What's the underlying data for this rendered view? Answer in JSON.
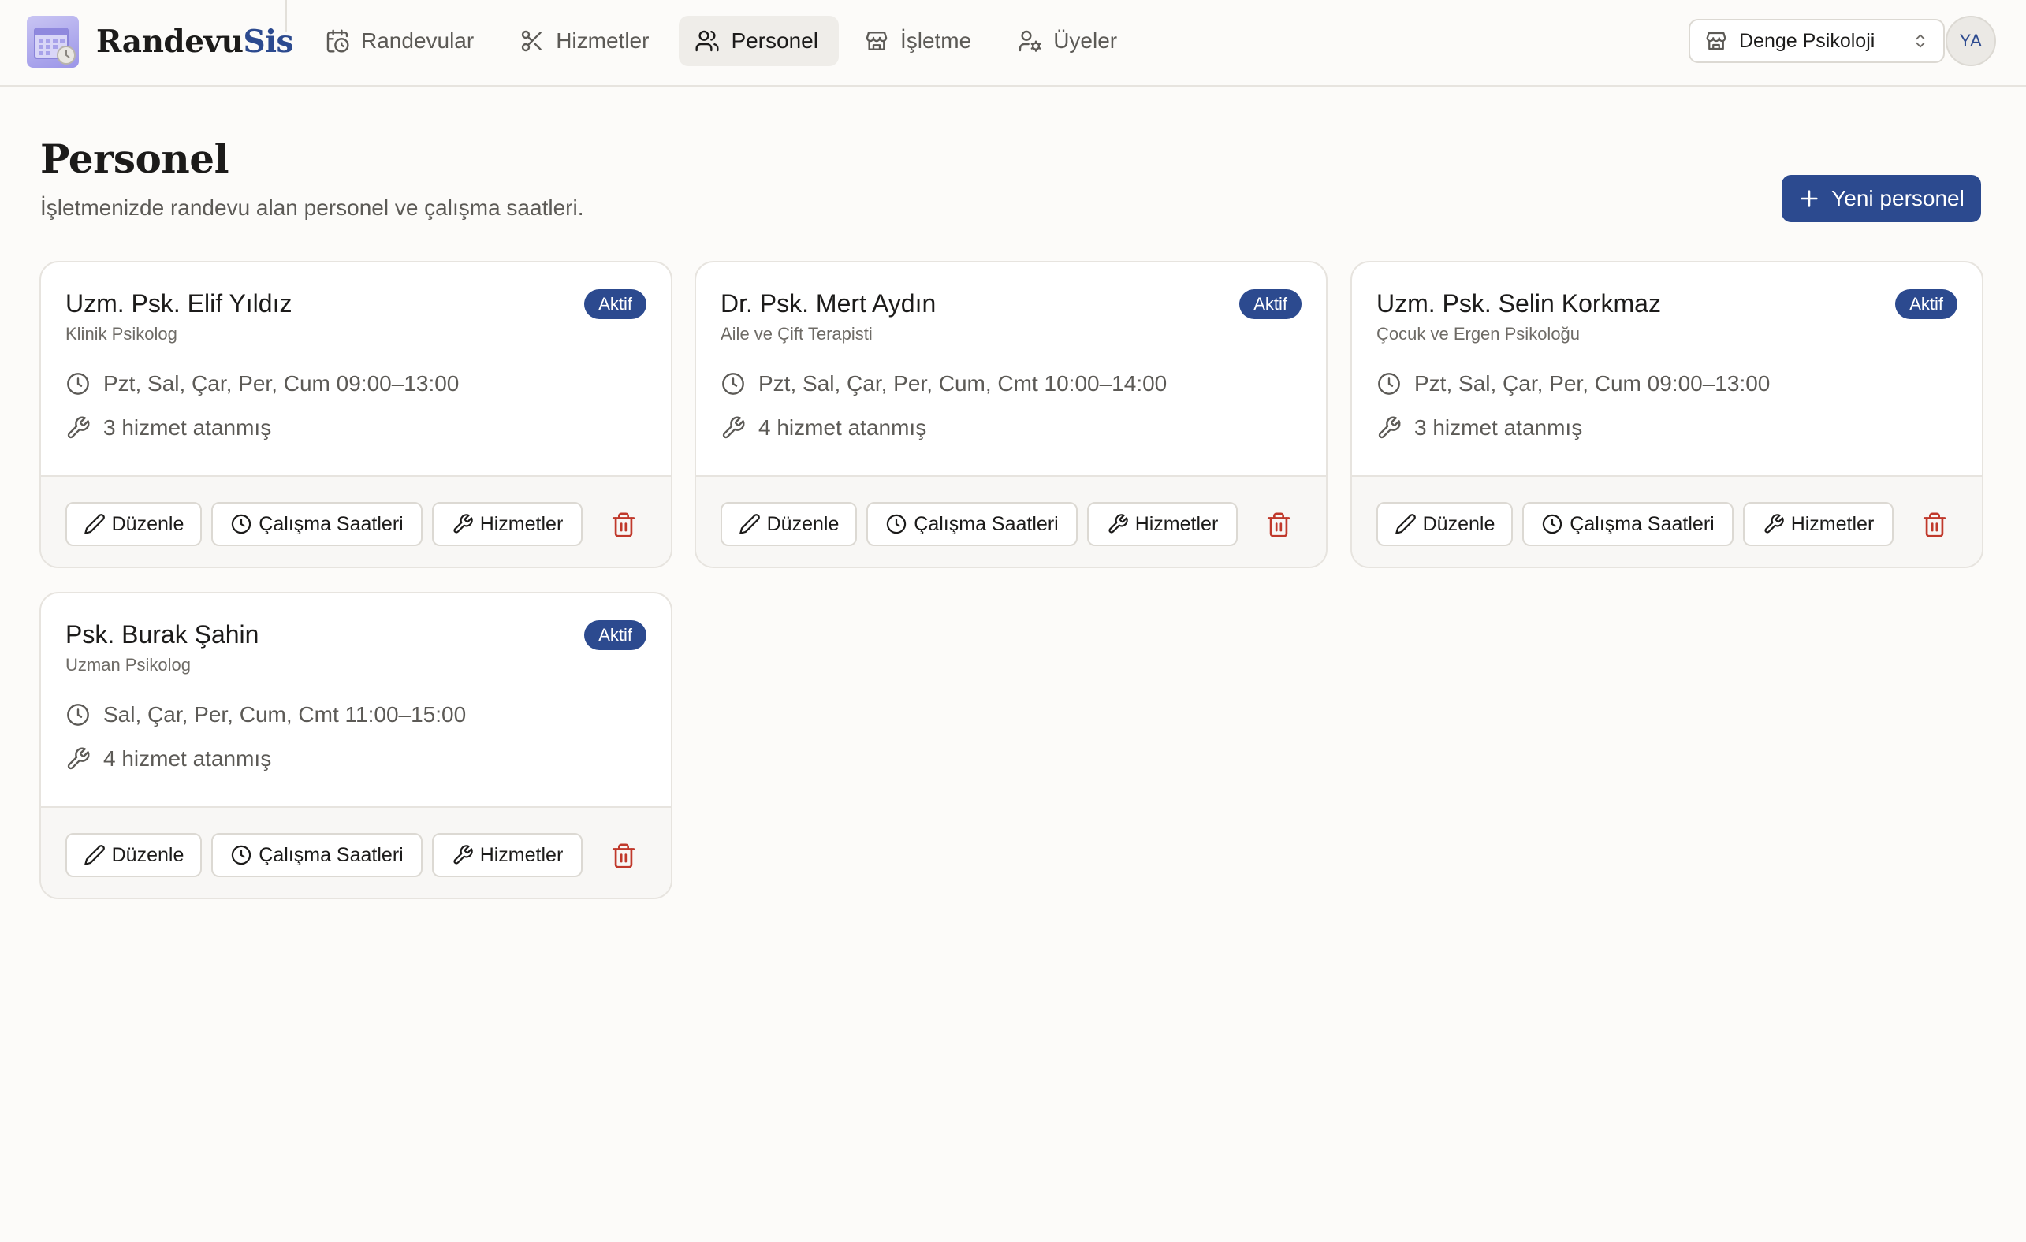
{
  "app": {
    "brand_main": "Randevu",
    "brand_accent": "Sis",
    "accent_color": "#2c4a8f"
  },
  "nav": {
    "items": [
      {
        "label": "Randevular",
        "icon": "calendar-clock-icon",
        "active": false
      },
      {
        "label": "Hizmetler",
        "icon": "scissors-icon",
        "active": false
      },
      {
        "label": "Personel",
        "icon": "users-icon",
        "active": true
      },
      {
        "label": "İşletme",
        "icon": "store-icon",
        "active": false
      },
      {
        "label": "Üyeler",
        "icon": "user-cog-icon",
        "active": false
      }
    ]
  },
  "business_select": {
    "label": "Denge Psikoloji",
    "icon": "store-icon"
  },
  "user": {
    "initials": "YA"
  },
  "page": {
    "title": "Personel",
    "subtitle": "İşletmenizde randevu alan personel ve çalışma saatleri.",
    "new_button": "Yeni personel"
  },
  "staff": [
    {
      "name": "Uzm. Psk. Elif Yıldız",
      "role": "Klinik Psikolog",
      "status": "Aktif",
      "hours": "Pzt, Sal, Çar, Per, Cum 09:00–13:00",
      "services": "3 hizmet atanmış"
    },
    {
      "name": "Dr. Psk. Mert Aydın",
      "role": "Aile ve Çift Terapisti",
      "status": "Aktif",
      "hours": "Pzt, Sal, Çar, Per, Cum, Cmt 10:00–14:00",
      "services": "4 hizmet atanmış"
    },
    {
      "name": "Uzm. Psk. Selin Korkmaz",
      "role": "Çocuk ve Ergen Psikoloğu",
      "status": "Aktif",
      "hours": "Pzt, Sal, Çar, Per, Cum 09:00–13:00",
      "services": "3 hizmet atanmış"
    },
    {
      "name": "Psk. Burak Şahin",
      "role": "Uzman Psikolog",
      "status": "Aktif",
      "hours": "Sal, Çar, Per, Cum, Cmt 11:00–15:00",
      "services": "4 hizmet atanmış"
    }
  ],
  "card_actions": {
    "edit": "Düzenle",
    "hours": "Çalışma Saatleri",
    "services": "Hizmetler"
  }
}
